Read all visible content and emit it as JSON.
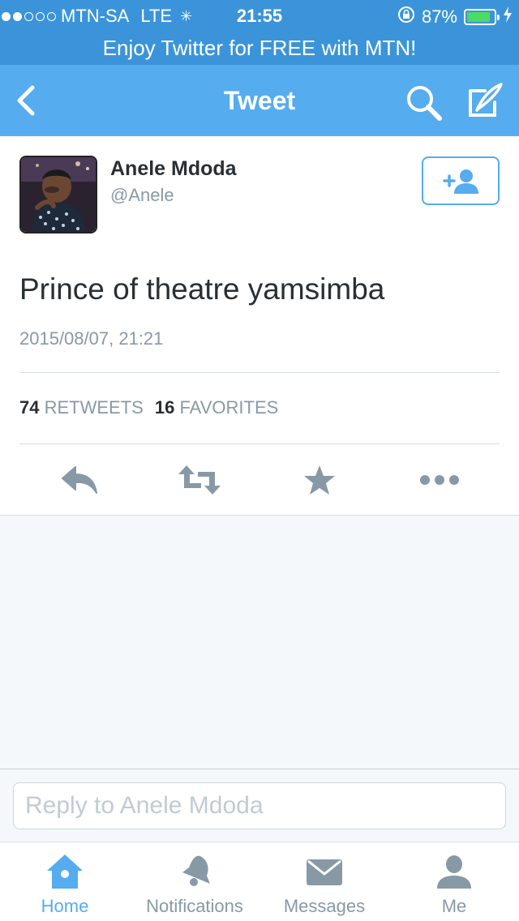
{
  "status_bar": {
    "carrier": "MTN-SA",
    "network": "LTE",
    "time": "21:55",
    "battery_text": "87%",
    "battery_level": 0.87,
    "signal_bars_filled": 2,
    "signal_bars_total": 5
  },
  "promo": {
    "text": "Enjoy Twitter for FREE with MTN!"
  },
  "nav": {
    "title": "Tweet",
    "back_icon": "chevron-left-icon",
    "search_icon": "search-icon",
    "compose_icon": "compose-icon"
  },
  "tweet": {
    "user": {
      "name": "Anele Mdoda",
      "handle": "@Anele"
    },
    "text": "Prince of theatre yamsimba",
    "timestamp": "2015/08/07, 21:21",
    "stats": {
      "retweets_count": "74",
      "retweets_label": "RETWEETS",
      "favorites_count": "16",
      "favorites_label": "FAVORITES"
    },
    "actions": [
      "reply-icon",
      "retweet-icon",
      "favorite-icon",
      "more-icon"
    ]
  },
  "reply": {
    "placeholder": "Reply to Anele Mdoda"
  },
  "tabs": [
    {
      "label": "Home",
      "icon": "home-icon",
      "active": true
    },
    {
      "label": "Notifications",
      "icon": "bell-icon",
      "active": false
    },
    {
      "label": "Messages",
      "icon": "envelope-icon",
      "active": false
    },
    {
      "label": "Me",
      "icon": "person-icon",
      "active": false
    }
  ],
  "colors": {
    "brand_blue": "#55acee",
    "status_blue": "#3b94d9",
    "icon_gray": "#8899a6",
    "battery_green": "#4cd964"
  }
}
